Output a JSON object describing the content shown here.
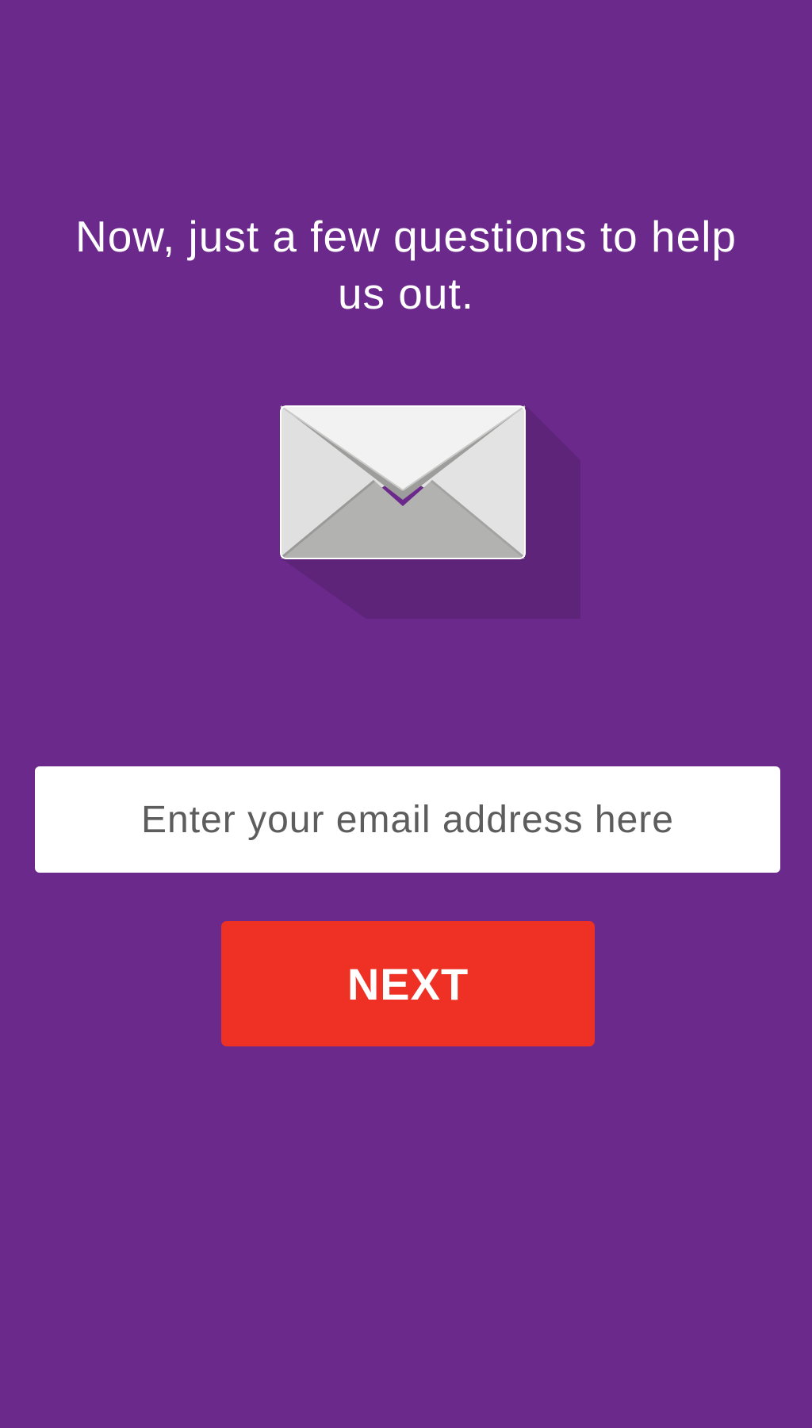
{
  "onboarding": {
    "heading": "Now, just a few questions to help us out.",
    "email": {
      "value": "",
      "placeholder": "Enter your email address here"
    },
    "next_label": "NEXT"
  },
  "icons": {
    "envelope": "envelope-icon"
  },
  "colors": {
    "background": "#6b298b",
    "button": "#ee3124",
    "input_background": "#ffffff",
    "input_text": "#5d5d5d",
    "heading_text": "#ffffff"
  }
}
